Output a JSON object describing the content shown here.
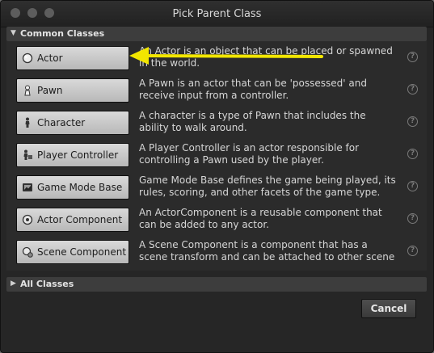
{
  "window": {
    "title": "Pick Parent Class"
  },
  "sections": {
    "common": {
      "label": "Common Classes"
    },
    "all": {
      "label": "All Classes"
    }
  },
  "classes": [
    {
      "label": "Actor",
      "icon": "actor-icon",
      "description": "An Actor is an object that can be placed or spawned in the world."
    },
    {
      "label": "Pawn",
      "icon": "pawn-icon",
      "description": "A Pawn is an actor that can be 'possessed' and receive input from a controller."
    },
    {
      "label": "Character",
      "icon": "character-icon",
      "description": "A character is a type of Pawn that includes the ability to walk around."
    },
    {
      "label": "Player Controller",
      "icon": "player-controller-icon",
      "description": "A Player Controller is an actor responsible for controlling a Pawn used by the player."
    },
    {
      "label": "Game Mode Base",
      "icon": "game-mode-icon",
      "description": "Game Mode Base defines the game being played, its rules, scoring, and other facets of the game type."
    },
    {
      "label": "Actor Component",
      "icon": "actor-component-icon",
      "description": "An ActorComponent is a reusable component that can be added to any actor."
    },
    {
      "label": "Scene Component",
      "icon": "scene-component-icon",
      "description": "A Scene Component is a component that has a scene transform and can be attached to other scene"
    }
  ],
  "help_glyph": "?",
  "footer": {
    "cancel_label": "Cancel"
  },
  "colors": {
    "annotation_arrow": "#f2e600",
    "background": "#262626"
  }
}
